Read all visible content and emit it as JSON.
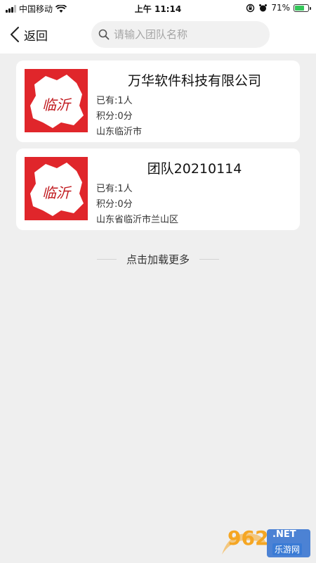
{
  "status_bar": {
    "carrier": "中国移动",
    "time": "上午 11:14",
    "battery": "71%",
    "battery_level": 0.71
  },
  "header": {
    "back_label": "返回",
    "search_placeholder": "请输入团队名称",
    "search_value": ""
  },
  "teams": [
    {
      "name": "万华软件科技有限公司",
      "members": "已有:1人",
      "points": "积分:0分",
      "location": "山东临沂市",
      "logo_text": "临沂"
    },
    {
      "name": "团队20210114",
      "members": "已有:1人",
      "points": "积分:0分",
      "location": "山东省临沂市兰山区",
      "logo_text": "临沂"
    }
  ],
  "load_more": "点击加载更多",
  "watermark": {
    "number": "962",
    "suffix": ".NET",
    "chinese": "乐游网"
  },
  "colors": {
    "logo_red": "#e0262b",
    "page_bg": "#efefef",
    "battery_green": "#34c759"
  }
}
